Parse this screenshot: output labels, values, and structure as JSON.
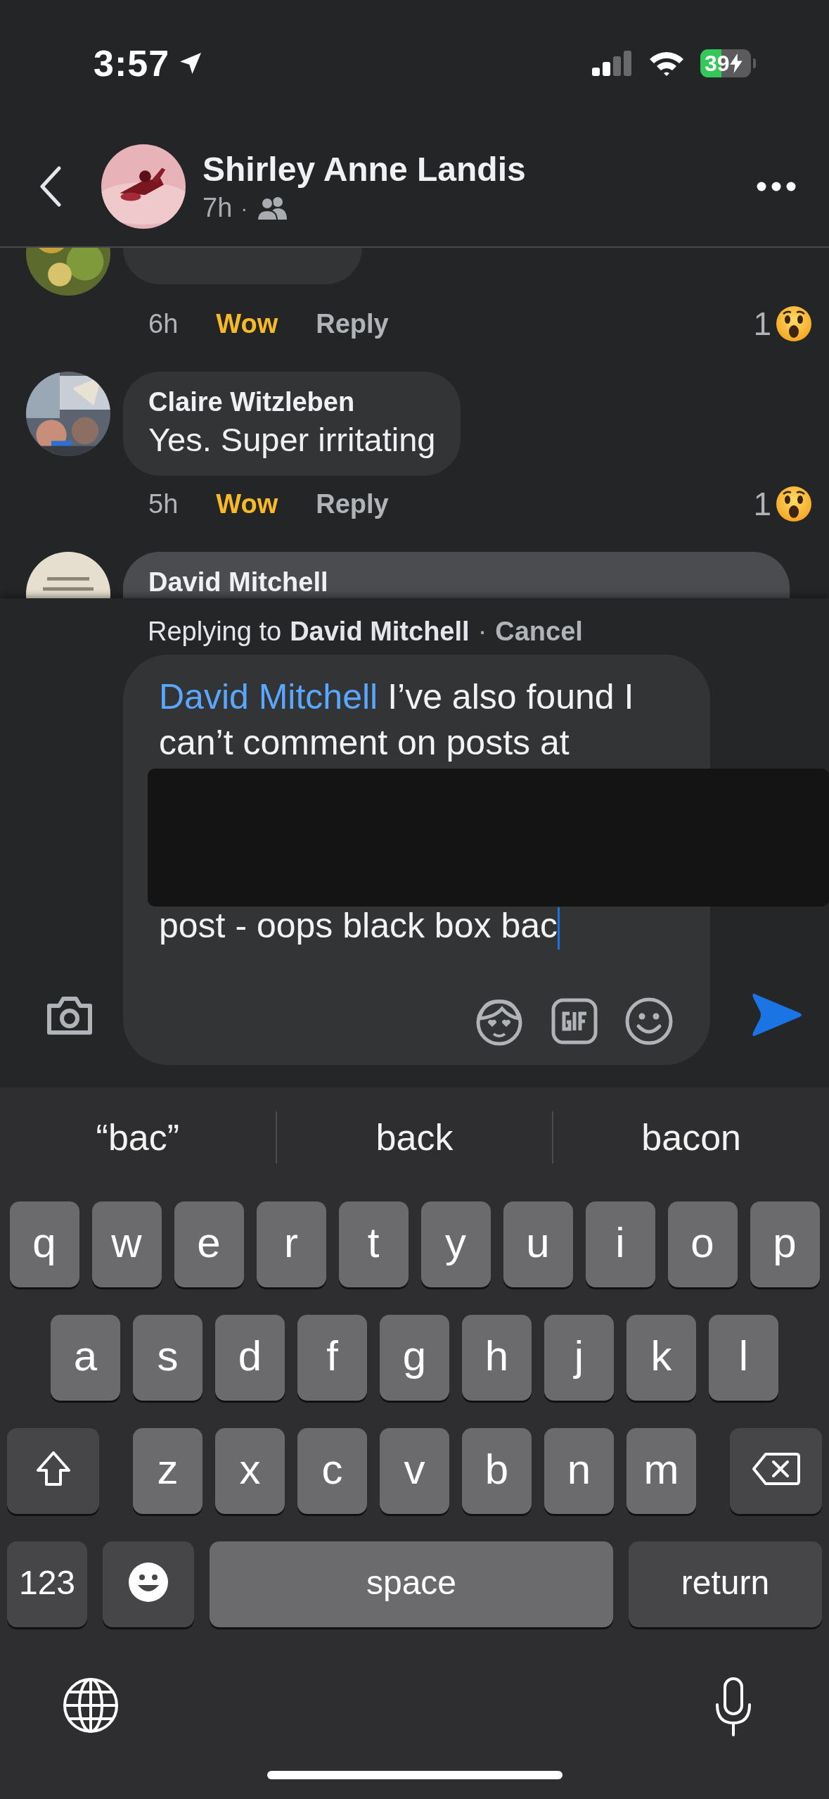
{
  "status_bar": {
    "time": "3:57",
    "battery": "39"
  },
  "header": {
    "name": "Shirley Anne Landis",
    "time": "7h",
    "separator": "·"
  },
  "comments": [
    {
      "time": "6h",
      "reaction_label": "Wow",
      "reacted": true,
      "reply": "Reply",
      "reaction_count": "1",
      "highlighted": false
    },
    {
      "author": "Claire Witzleben",
      "text": "Yes. Super irritating",
      "time": "5h",
      "reaction_label": "Wow",
      "reacted": true,
      "reply": "Reply",
      "reaction_count": "1",
      "highlighted": false
    },
    {
      "author": "David Mitchell",
      "highlighted": true
    }
  ],
  "composer": {
    "replying_prefix": "Replying to",
    "replying_name": "David Mitchell",
    "separator": "·",
    "cancel": "Cancel",
    "mention": "David Mitchell",
    "text_lines_above": [
      "I’ve also found I",
      "can’t comment on posts at"
    ],
    "text_lines_below": [
      "post - oops black box bac"
    ]
  },
  "keyboard": {
    "suggestions": [
      "“bac”",
      "back",
      "bacon"
    ],
    "rows": [
      [
        "q",
        "w",
        "e",
        "r",
        "t",
        "y",
        "u",
        "i",
        "o",
        "p"
      ],
      [
        "a",
        "s",
        "d",
        "f",
        "g",
        "h",
        "j",
        "k",
        "l"
      ],
      [
        "z",
        "x",
        "c",
        "v",
        "b",
        "n",
        "m"
      ]
    ],
    "numbers_key": "123",
    "space_key": "space",
    "return_key": "return"
  }
}
